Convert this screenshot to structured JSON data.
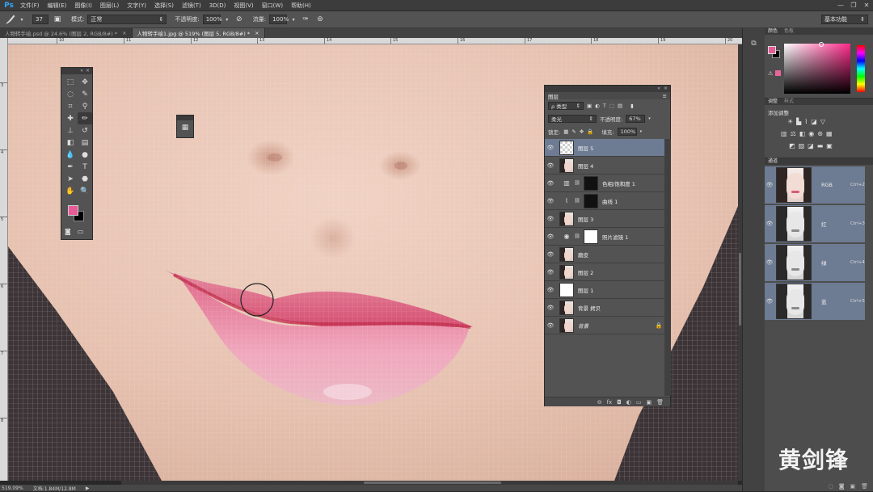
{
  "app": {
    "logo": "Ps"
  },
  "menu": [
    "文件(F)",
    "编辑(E)",
    "图像(I)",
    "图层(L)",
    "文字(Y)",
    "选择(S)",
    "滤镜(T)",
    "3D(D)",
    "视图(V)",
    "窗口(W)",
    "帮助(H)"
  ],
  "window_controls": [
    "—",
    "❐",
    "✕"
  ],
  "options": {
    "brush_size": "37",
    "mode_label": "模式:",
    "mode_value": "正常",
    "opacity_label": "不透明度:",
    "opacity_value": "100%",
    "flow_label": "流量:",
    "flow_value": "100%",
    "workspace": "基本功能"
  },
  "tabs": [
    {
      "label": "人物转手绘.psd @ 24.6% (图层 2, RGB/8#) *",
      "close": "×"
    },
    {
      "label": "人物转手绘1.jpg @ 519% (图层 5, RGB/8#) *",
      "close": "×"
    }
  ],
  "ruler_top": [
    "10",
    "11",
    "12",
    "13",
    "14",
    "15",
    "16",
    "17",
    "18",
    "19",
    "20"
  ],
  "ruler_left": [
    "3",
    "4",
    "5",
    "6",
    "7",
    "8"
  ],
  "status": {
    "zoom": "519.09%",
    "doc": "文档:1.84M/12.8M"
  },
  "layers_panel": {
    "title": "图层",
    "filter": "ρ 类型",
    "blend_mode": "柔光",
    "opacity_label": "不透明度:",
    "opacity_value": "67%",
    "lock_label": "锁定:",
    "fill_label": "填充:",
    "fill_value": "100%",
    "layers": [
      {
        "name": "图层 5"
      },
      {
        "name": "图层 4"
      },
      {
        "name": "色相/饱和度 1"
      },
      {
        "name": "曲线 1"
      },
      {
        "name": "图层 3"
      },
      {
        "name": "照片滤镜 1"
      },
      {
        "name": "磨皮"
      },
      {
        "name": "图层 2"
      },
      {
        "name": "图层 1"
      },
      {
        "name": "背景 拷贝"
      },
      {
        "name": "背景"
      }
    ],
    "footer_icons": [
      "⊖",
      "fx",
      "◘",
      "◐",
      "▭",
      "▣",
      "🗑"
    ]
  },
  "color_panel": {
    "tabs": [
      "颜色",
      "色板"
    ],
    "fg": "#e75b96",
    "bg": "#000000"
  },
  "adjust_panel": {
    "tabs": [
      "调整",
      "样式"
    ],
    "title": "添加调整"
  },
  "channels_panel": {
    "title": "通道",
    "channels": [
      {
        "name": "RGB",
        "shortcut": "Ctrl+2"
      },
      {
        "name": "红",
        "shortcut": "Ctrl+3"
      },
      {
        "name": "绿",
        "shortcut": "Ctrl+4"
      },
      {
        "name": "蓝",
        "shortcut": "Ctrl+5"
      }
    ]
  },
  "watermark": "黄剑锋",
  "colors": {
    "selected_layer": "#6d7b93",
    "lip": "#d94a6f",
    "skin": "#e8c4b4"
  }
}
